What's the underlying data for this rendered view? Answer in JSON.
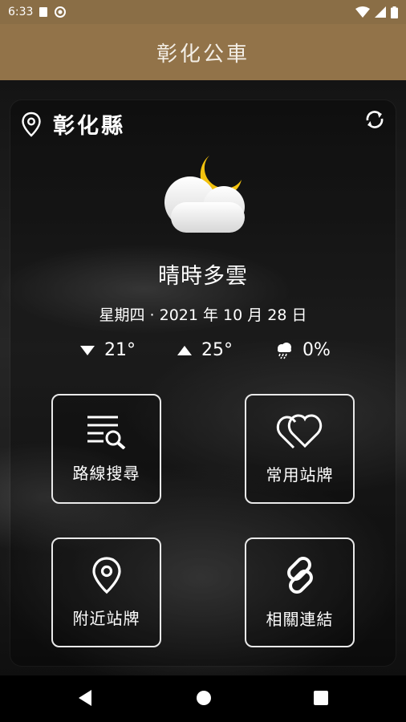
{
  "status_bar": {
    "time": "6:33"
  },
  "app_bar": {
    "title": "彰化公車"
  },
  "location": {
    "name": "彰化縣"
  },
  "weather": {
    "condition": "晴時多雲",
    "date": "星期四 · 2021 年 10 月 28 日",
    "low": "21°",
    "high": "25°",
    "rain": "0%"
  },
  "menu": [
    {
      "label": "路線搜尋",
      "icon": "route-search-icon"
    },
    {
      "label": "常用站牌",
      "icon": "heart-icon"
    },
    {
      "label": "附近站牌",
      "icon": "location-pin-icon"
    },
    {
      "label": "相關連結",
      "icon": "link-icon"
    }
  ],
  "colors": {
    "header": "#927349",
    "status_bar": "#8a6e46",
    "moon": "#f2c20e"
  }
}
